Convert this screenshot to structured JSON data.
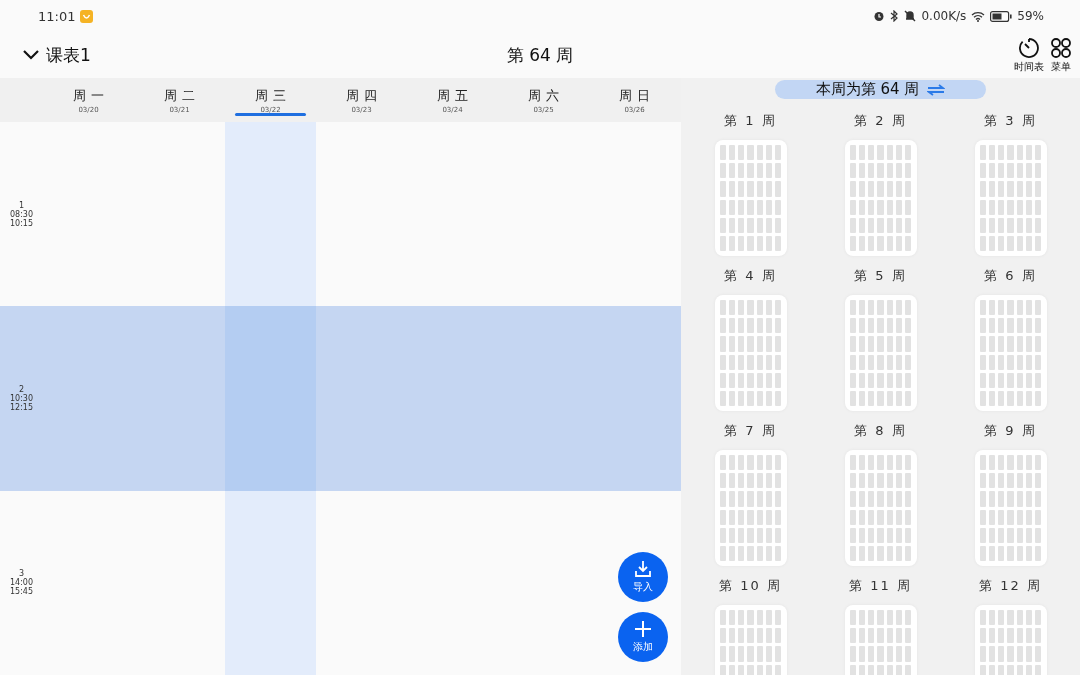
{
  "status_bar": {
    "time": "11:01",
    "speed": "0.00K/s",
    "battery": "59%"
  },
  "header": {
    "title": "课表1",
    "week": "第 64 周",
    "actions": [
      {
        "kind": "timer",
        "label": "时间表"
      },
      {
        "kind": "menu",
        "label": "菜单"
      }
    ]
  },
  "days": [
    {
      "name": "周 一",
      "date": "03/20",
      "selected": false
    },
    {
      "name": "周 二",
      "date": "03/21",
      "selected": false
    },
    {
      "name": "周 三",
      "date": "03/22",
      "selected": true
    },
    {
      "name": "周 四",
      "date": "03/23",
      "selected": false
    },
    {
      "name": "周 五",
      "date": "03/24",
      "selected": false
    },
    {
      "name": "周 六",
      "date": "03/25",
      "selected": false
    },
    {
      "name": "周 日",
      "date": "03/26",
      "selected": false
    }
  ],
  "periods": [
    {
      "number": "1",
      "start": "08:30",
      "end": "10:15",
      "selected": false
    },
    {
      "number": "2",
      "start": "10:30",
      "end": "12:15",
      "selected": true
    },
    {
      "number": "3",
      "start": "14:00",
      "end": "15:45",
      "selected": false
    }
  ],
  "floating_buttons": [
    {
      "kind": "import",
      "label": "导入"
    },
    {
      "kind": "add",
      "label": "添加"
    }
  ],
  "current_week_banner": "本周为第 64 周",
  "weeks": [
    "第 1 周",
    "第 2 周",
    "第 3 周",
    "第 4 周",
    "第 5 周",
    "第 6 周",
    "第 7 周",
    "第 8 周",
    "第 9 周",
    "第 10 周",
    "第 11 周",
    "第 12 周"
  ]
}
